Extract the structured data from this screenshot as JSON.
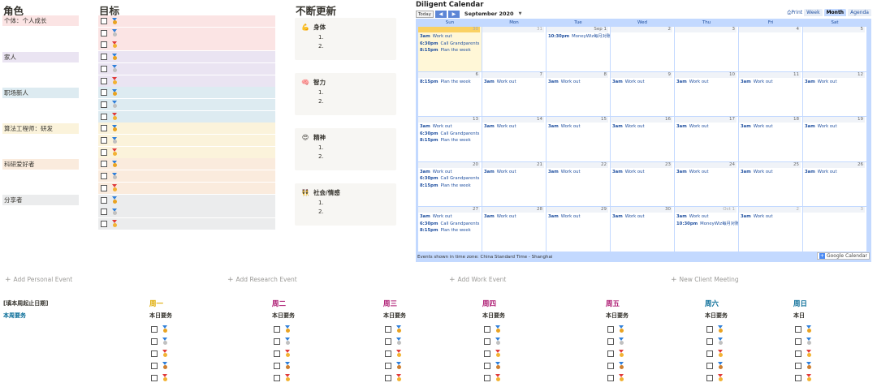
{
  "roles": {
    "title": "角色",
    "items": [
      {
        "label": "个体：个人成长",
        "color": "#fbe4e4"
      },
      {
        "label": "家人",
        "color": "#eae4f2"
      },
      {
        "label": "职场新人",
        "color": "#ddebf1"
      },
      {
        "label": "算法工程师：研发",
        "color": "#fbf3db"
      },
      {
        "label": "科研爱好者",
        "color": "#faebdd"
      },
      {
        "label": "分享者",
        "color": "#ebeced"
      }
    ]
  },
  "goals": {
    "title": "目标",
    "rows_per_role": 3
  },
  "growth": {
    "title": "不断更新",
    "cards": [
      {
        "icon": "💪",
        "title": "身体",
        "lines": [
          "1.",
          "2."
        ]
      },
      {
        "icon": "🧠",
        "title": "智力",
        "lines": [
          "1.",
          "2."
        ]
      },
      {
        "icon": "😍",
        "title": "精神",
        "lines": [
          "1.",
          "2."
        ]
      },
      {
        "icon": "👯",
        "title": "社会/情感",
        "lines": [
          "1.",
          "2."
        ]
      }
    ]
  },
  "calendar": {
    "title": "Diligent Calendar",
    "today_label": "Today",
    "month_label": "September 2020",
    "dropdown_icon": "▼",
    "print_label": "Print",
    "views": [
      "Week",
      "Month",
      "Agenda"
    ],
    "weekdays": [
      "Sun",
      "Mon",
      "Tue",
      "Wed",
      "Thu",
      "Fri",
      "Sat"
    ],
    "weeks": [
      [
        {
          "d": "30",
          "other": true,
          "today": true,
          "events": [
            [
              "3am",
              "Work out"
            ],
            [
              "6:30pm",
              "Call Grandparents"
            ],
            [
              "8:15pm",
              "Plan the week"
            ]
          ]
        },
        {
          "d": "31",
          "other": true,
          "events": []
        },
        {
          "d": "Sep 1",
          "events": [
            [
              "10:30pm",
              "MoneyWiz每月对账"
            ]
          ]
        },
        {
          "d": "2",
          "events": []
        },
        {
          "d": "3",
          "events": []
        },
        {
          "d": "4",
          "events": []
        },
        {
          "d": "5",
          "events": []
        }
      ],
      [
        {
          "d": "6",
          "events": [
            [
              "8:15pm",
              "Plan the week"
            ]
          ]
        },
        {
          "d": "7",
          "events": [
            [
              "3am",
              "Work out"
            ]
          ]
        },
        {
          "d": "8",
          "events": [
            [
              "3am",
              "Work out"
            ]
          ]
        },
        {
          "d": "9",
          "events": [
            [
              "3am",
              "Work out"
            ]
          ]
        },
        {
          "d": "10",
          "events": [
            [
              "3am",
              "Work out"
            ]
          ]
        },
        {
          "d": "11",
          "events": [
            [
              "3am",
              "Work out"
            ]
          ]
        },
        {
          "d": "12",
          "events": [
            [
              "3am",
              "Work out"
            ]
          ]
        }
      ],
      [
        {
          "d": "13",
          "events": [
            [
              "3am",
              "Work out"
            ],
            [
              "6:30pm",
              "Call Grandparents"
            ],
            [
              "8:15pm",
              "Plan the week"
            ]
          ]
        },
        {
          "d": "14",
          "events": [
            [
              "3am",
              "Work out"
            ]
          ]
        },
        {
          "d": "15",
          "events": [
            [
              "3am",
              "Work out"
            ]
          ]
        },
        {
          "d": "16",
          "events": [
            [
              "3am",
              "Work out"
            ]
          ]
        },
        {
          "d": "17",
          "events": [
            [
              "3am",
              "Work out"
            ]
          ]
        },
        {
          "d": "18",
          "events": [
            [
              "3am",
              "Work out"
            ]
          ]
        },
        {
          "d": "19",
          "events": [
            [
              "3am",
              "Work out"
            ]
          ]
        }
      ],
      [
        {
          "d": "20",
          "events": [
            [
              "3am",
              "Work out"
            ],
            [
              "6:30pm",
              "Call Grandparents"
            ],
            [
              "8:15pm",
              "Plan the week"
            ]
          ]
        },
        {
          "d": "21",
          "events": [
            [
              "3am",
              "Work out"
            ]
          ]
        },
        {
          "d": "22",
          "events": [
            [
              "3am",
              "Work out"
            ]
          ]
        },
        {
          "d": "23",
          "events": [
            [
              "3am",
              "Work out"
            ]
          ]
        },
        {
          "d": "24",
          "events": [
            [
              "3am",
              "Work out"
            ]
          ]
        },
        {
          "d": "25",
          "events": [
            [
              "3am",
              "Work out"
            ]
          ]
        },
        {
          "d": "26",
          "events": [
            [
              "3am",
              "Work out"
            ]
          ]
        }
      ],
      [
        {
          "d": "27",
          "events": [
            [
              "3am",
              "Work out"
            ],
            [
              "6:30pm",
              "Call Grandparents"
            ],
            [
              "8:15pm",
              "Plan the week"
            ]
          ]
        },
        {
          "d": "28",
          "events": [
            [
              "3am",
              "Work out"
            ]
          ]
        },
        {
          "d": "29",
          "events": [
            [
              "3am",
              "Work out"
            ]
          ]
        },
        {
          "d": "30",
          "events": [
            [
              "3am",
              "Work out"
            ]
          ]
        },
        {
          "d": "Oct 1",
          "other": true,
          "events": [
            [
              "3am",
              "Work out"
            ],
            [
              "10:30pm",
              "MoneyWiz每月对账"
            ]
          ]
        },
        {
          "d": "2",
          "other": true,
          "events": [
            [
              "3am",
              "Work out"
            ]
          ]
        },
        {
          "d": "3",
          "other": true,
          "events": []
        }
      ]
    ],
    "footer": "Events shown in time zone: China Standard Time - Shanghai",
    "brand": "Google Calendar",
    "brand_icon": "+"
  },
  "add_buttons": [
    "Add Personal Event",
    "Add Research Event",
    "Add Work Event",
    "New Client Meeting"
  ],
  "weekly": {
    "date_label": "[填本周起止日期]",
    "tasks_label": "本周要务",
    "days": [
      {
        "name": "周一",
        "sub": "本日要务",
        "color": "#dfab01"
      },
      {
        "name": "周二",
        "sub": "本日要务",
        "color": "#ad1a72"
      },
      {
        "name": "周三",
        "sub": "本日要务",
        "color": "#ad1a72"
      },
      {
        "name": "周四",
        "sub": "本日要务",
        "color": "#ad1a72"
      },
      {
        "name": "周五",
        "sub": "本日要务",
        "color": "#ad1a72"
      },
      {
        "name": "周六",
        "sub": "本日要务",
        "color": "#0b6e99"
      },
      {
        "name": "周日",
        "sub": "本日",
        "color": "#0b6e99"
      }
    ]
  }
}
